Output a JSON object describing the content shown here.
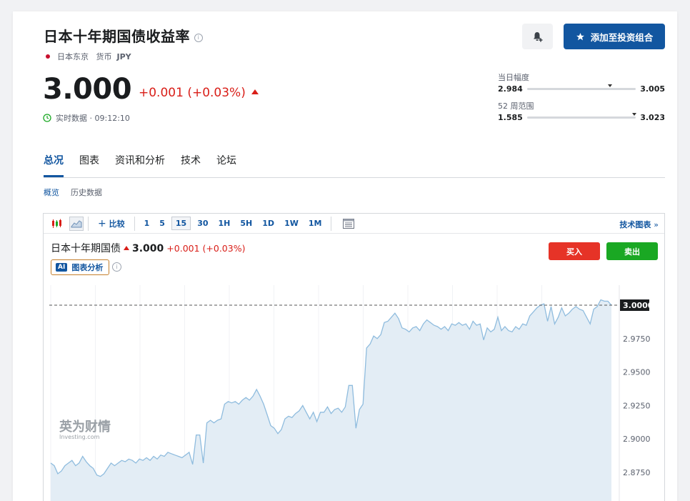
{
  "header": {
    "title": "日本十年期国债收益率",
    "info_icon": "info-icon",
    "exchange": "日本东京",
    "currency_label": "货币",
    "currency": "JPY",
    "add_button": "添加至投资组合",
    "bell_icon": "bell-plus-icon",
    "star_icon": "star-icon"
  },
  "quote": {
    "price": "3.000",
    "change": "+0.001 (+0.03%)",
    "status": "实时数据 · 09:12:10",
    "up_color": "#d91e18"
  },
  "ranges": {
    "day": {
      "label": "当日幅度",
      "low": "2.984",
      "high": "3.005",
      "current": 3.0
    },
    "week52": {
      "label": "52 周范围",
      "low": "1.585",
      "high": "3.023",
      "current": 3.0
    }
  },
  "tabs": [
    "总况",
    "图表",
    "资讯和分析",
    "技术",
    "论坛"
  ],
  "subtabs": [
    "概览",
    "历史数据"
  ],
  "toolbar": {
    "compare": "比较",
    "intervals": [
      "1",
      "5",
      "15",
      "30",
      "1H",
      "5H",
      "1D",
      "1W",
      "1M"
    ],
    "selected_interval": "15",
    "tech_chart": "技术图表"
  },
  "chart_panel": {
    "name": "日本十年期国债",
    "value": "3.000",
    "change": "+0.001 (+0.03%)",
    "ai_badge": "AI",
    "ai_label": "图表分析",
    "buy": "买入",
    "sell": "卖出",
    "watermark_cn": "英为财情",
    "watermark_en": "Investing.com"
  },
  "chart_data": {
    "type": "area",
    "title": "",
    "xlabel": "",
    "ylabel": "",
    "ylim": [
      2.86,
      3.015
    ],
    "y_ticks": [
      "3.0000",
      "2.9750",
      "2.9500",
      "2.9250",
      "2.9000",
      "2.8750"
    ],
    "current_label": "3.0000",
    "current_value": 3.0,
    "line_color": "#8fbcde",
    "fill_color": "#e3edf5",
    "values": [
      2.882,
      2.88,
      2.874,
      2.876,
      2.88,
      2.882,
      2.884,
      2.88,
      2.882,
      2.887,
      2.883,
      2.88,
      2.878,
      2.873,
      2.872,
      2.874,
      2.878,
      2.882,
      2.88,
      2.882,
      2.884,
      2.883,
      2.885,
      2.884,
      2.882,
      2.885,
      2.884,
      2.886,
      2.884,
      2.887,
      2.885,
      2.888,
      2.887,
      2.89,
      2.889,
      2.888,
      2.887,
      2.886,
      2.888,
      2.89,
      2.881,
      2.903,
      2.903,
      2.882,
      2.912,
      2.914,
      2.912,
      2.914,
      2.915,
      2.926,
      2.928,
      2.927,
      2.928,
      2.926,
      2.929,
      2.931,
      2.929,
      2.932,
      2.937,
      2.932,
      2.926,
      2.918,
      2.91,
      2.908,
      2.904,
      2.907,
      2.915,
      2.917,
      2.916,
      2.919,
      2.921,
      2.925,
      2.92,
      2.915,
      2.92,
      2.913,
      2.92,
      2.92,
      2.924,
      2.919,
      2.922,
      2.923,
      2.92,
      2.924,
      2.94,
      2.94,
      2.908,
      2.922,
      2.926,
      2.968,
      2.971,
      2.977,
      2.975,
      2.978,
      2.987,
      2.988,
      2.991,
      2.994,
      2.99,
      2.983,
      2.982,
      2.98,
      2.983,
      2.984,
      2.981,
      2.986,
      2.989,
      2.987,
      2.985,
      2.984,
      2.982,
      2.984,
      2.981,
      2.986,
      2.985,
      2.987,
      2.985,
      2.986,
      2.982,
      2.988,
      2.985,
      2.986,
      2.974,
      2.983,
      2.98,
      2.982,
      2.991,
      2.981,
      2.984,
      2.981,
      2.98,
      2.984,
      2.982,
      2.986,
      2.985,
      2.992,
      2.995,
      2.998,
      3.0,
      3.001,
      2.988,
      2.999,
      2.986,
      2.991,
      2.998,
      2.992,
      2.994,
      2.997,
      2.999,
      2.997,
      2.996,
      2.991,
      2.986,
      2.997,
      2.999,
      3.004,
      3.003,
      3.003,
      3.0
    ]
  }
}
